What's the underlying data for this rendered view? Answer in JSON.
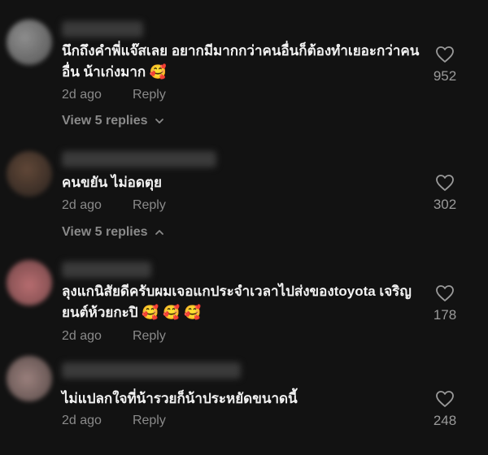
{
  "comments": [
    {
      "text": "นึกถึงคำพี่แจ๊สเลย อยากมีมากกว่าคนอื่นก็ต้องทำเยอะกว่าคนอื่น น้าเก่งมาก 🥰",
      "time": "2d ago",
      "reply_label": "Reply",
      "view_replies": "View 5 replies",
      "likes": "952"
    },
    {
      "text": "คนขยัน ไม่อดตุย",
      "time": "2d ago",
      "reply_label": "Reply",
      "view_replies": "View 5 replies",
      "likes": "302"
    },
    {
      "text": "ลุงแกนิสัยดีครับผมเจอแกประจำเวลาไปส่งของtoyota เจริญยนต์ห้วยกะปิ 🥰 🥰 🥰",
      "time": "2d ago",
      "reply_label": "Reply",
      "likes": "178"
    },
    {
      "text": "ไม่แปลกใจที่น้ารวยก็น้าประหยัดขนาดนี้",
      "time": "2d ago",
      "reply_label": "Reply",
      "likes": "248"
    }
  ],
  "icons": {
    "like": "heart-outline-icon",
    "expand": "chevron-down-icon"
  },
  "colors": {
    "background": "#121212",
    "text": "#f2f2f2",
    "muted": "#8a8a8a"
  }
}
